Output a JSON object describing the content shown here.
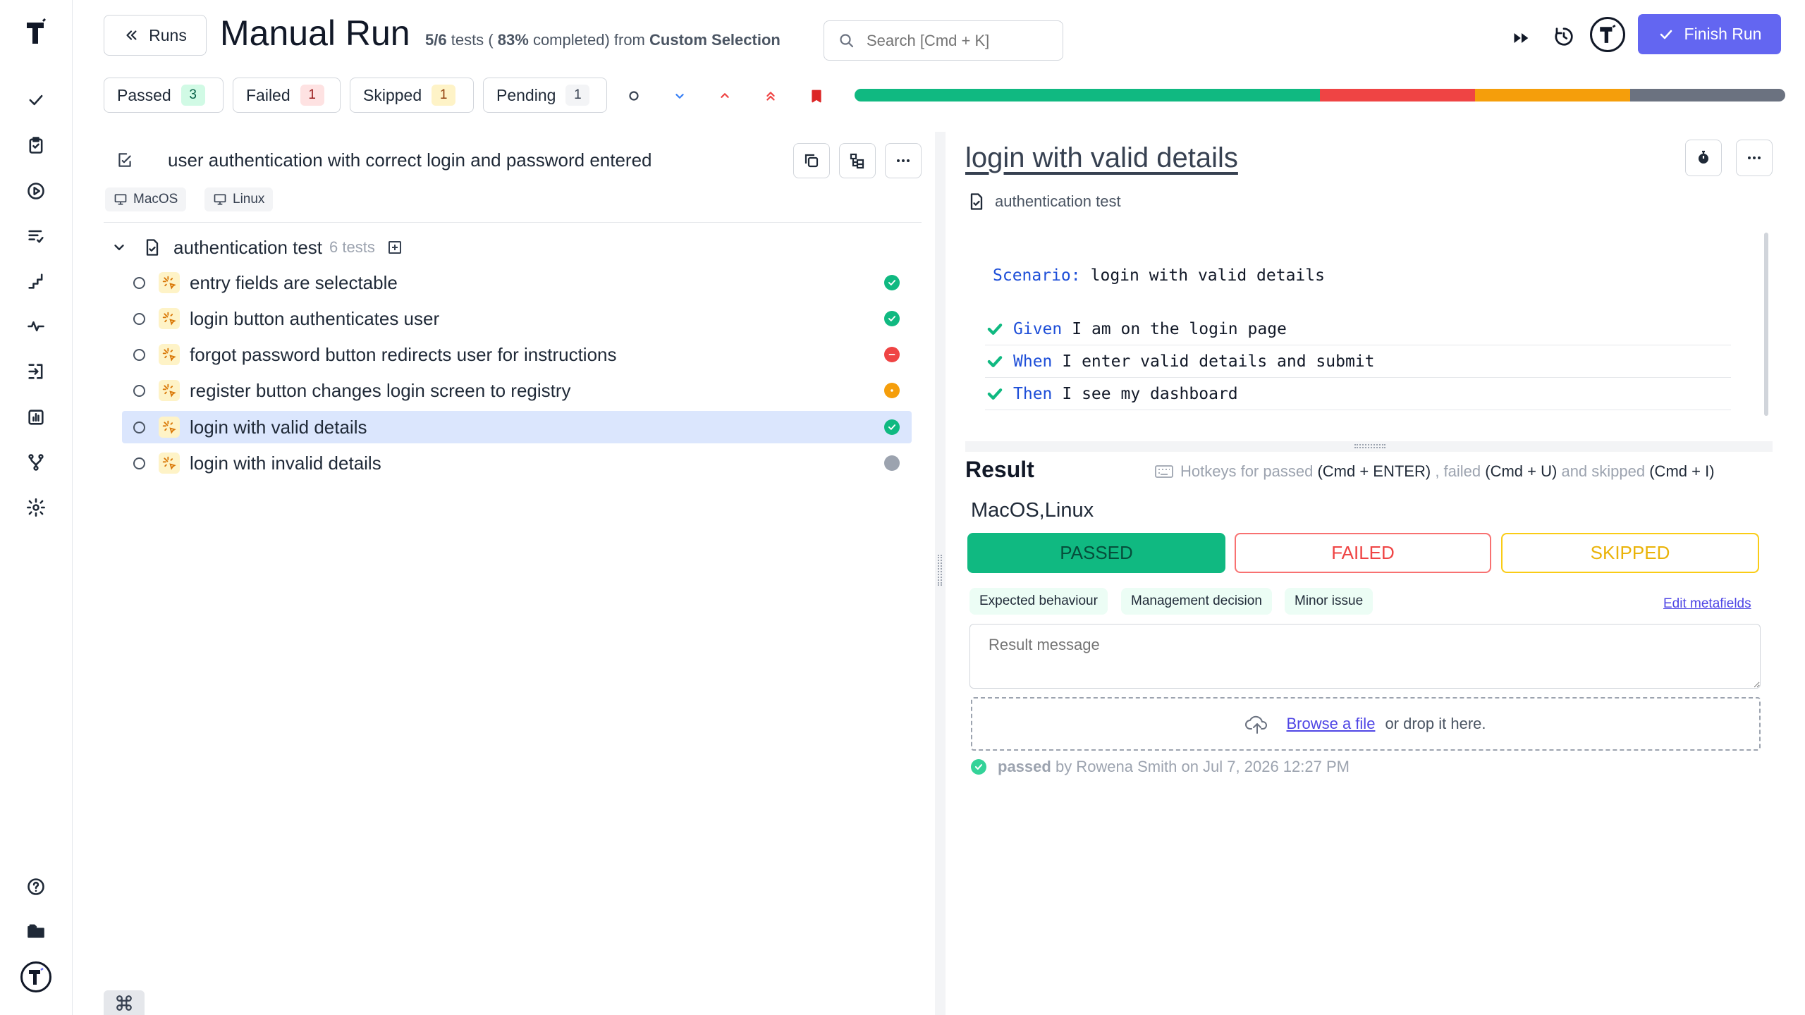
{
  "header": {
    "back_label": "Runs",
    "title": "Manual Run",
    "progress_tests": "5/6",
    "tests_word": "tests",
    "open_paren": "(",
    "percent": "83%",
    "completed_from": "completed) from",
    "source": "Custom Selection",
    "search_placeholder": "Search [Cmd + K]",
    "finish_label": "Finish Run"
  },
  "filters": [
    {
      "label": "Passed",
      "count": "3"
    },
    {
      "label": "Failed",
      "count": "1"
    },
    {
      "label": "Skipped",
      "count": "1"
    },
    {
      "label": "Pending",
      "count": "1"
    }
  ],
  "progress": {
    "passed": 3,
    "failed": 1,
    "skipped": 1,
    "pending": 1,
    "colors": {
      "passed": "#10b981",
      "failed": "#ef4444",
      "skipped": "#f59e0b",
      "pending": "#6b7280"
    }
  },
  "left": {
    "run_title": "user authentication with correct login and password entered",
    "environments": [
      "MacOS",
      "Linux"
    ],
    "suite": {
      "name": "authentication test",
      "count": "6 tests"
    },
    "tests": [
      {
        "title": "entry fields are selectable",
        "status": "passed"
      },
      {
        "title": "login button authenticates user",
        "status": "passed"
      },
      {
        "title": "forgot password button redirects user for instructions",
        "status": "failed"
      },
      {
        "title": "register button changes login screen to registry",
        "status": "skipped"
      },
      {
        "title": "login with valid details",
        "status": "passed",
        "selected": true
      },
      {
        "title": "login with invalid details",
        "status": "pending"
      }
    ]
  },
  "detail": {
    "title": "login with valid details",
    "suite": "authentication test",
    "scenario_kw": "Scenario:",
    "scenario": "login with valid details",
    "steps": [
      {
        "kw": "Given",
        "text": "I am on the login page"
      },
      {
        "kw": "When",
        "text": "I enter valid details and submit"
      },
      {
        "kw": "Then",
        "text": "I see my dashboard"
      }
    ],
    "result_heading": "Result",
    "hotkeys": {
      "prefix": "Hotkeys for passed",
      "passed_key": "(Cmd + ENTER)",
      "failed_word": ", failed",
      "failed_key": "(Cmd + U)",
      "and_skipped": "and skipped",
      "skipped_key": "(Cmd + I)"
    },
    "env": "MacOS,Linux",
    "buttons": {
      "passed": "PASSED",
      "failed": "FAILED",
      "skipped": "SKIPPED"
    },
    "metafields": [
      "Expected behaviour",
      "Management decision",
      "Minor issue"
    ],
    "edit_metafields": "Edit metafields",
    "message_placeholder": "Result message",
    "upload": {
      "link": "Browse a file",
      "rest": "or drop it here."
    },
    "history": {
      "status": "passed",
      "by": "by Rowena Smith on Jul 7, 2026 12:27 PM"
    }
  },
  "colors": {
    "accent": "#6366f1",
    "passed": "#10b981",
    "failed": "#ef4444",
    "skipped": "#f59e0b",
    "pending": "#9ca3af",
    "selected_row": "#dbe6fd"
  }
}
